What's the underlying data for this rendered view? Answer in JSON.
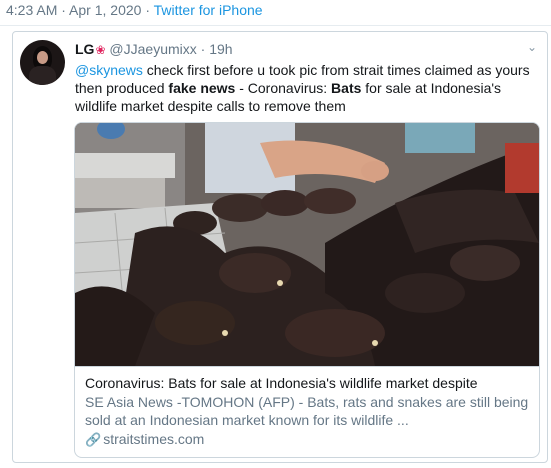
{
  "meta": {
    "time": "4:23 AM",
    "separator": " · ",
    "date": "Apr 1, 2020",
    "source": "Twitter for iPhone"
  },
  "quoted_tweet": {
    "display_name": "LG",
    "flower_icon": "❀",
    "handle": "@JJaeyumixx",
    "time_separator": " · ",
    "time": "19h",
    "text_mention": "@skynews",
    "text_part1": " check first before u took pic from strait times claimed as yours then produced ",
    "text_bold1": "fake news",
    "text_part2": " -  Coronavirus: ",
    "text_bold2": "Bats",
    "text_part3": " for sale at Indonesia's wildlife market despite calls to remove them",
    "chevron": "⌄"
  },
  "link_card": {
    "title": "Coronavirus: Bats for sale at Indonesia's wildlife market despite",
    "description": "SE Asia News -TOMOHON (AFP) - Bats, rats and snakes are still being sold at an Indonesian market known for its wildlife ...",
    "domain": "straitstimes.com",
    "link_icon": "🔗"
  },
  "colors": {
    "link_blue": "#1b95e0",
    "muted_gray": "#657786",
    "border": "#ccd6dd",
    "flower_red": "#e0245e"
  },
  "icons": [
    "flower-icon",
    "chevron-down-icon",
    "link-icon"
  ]
}
